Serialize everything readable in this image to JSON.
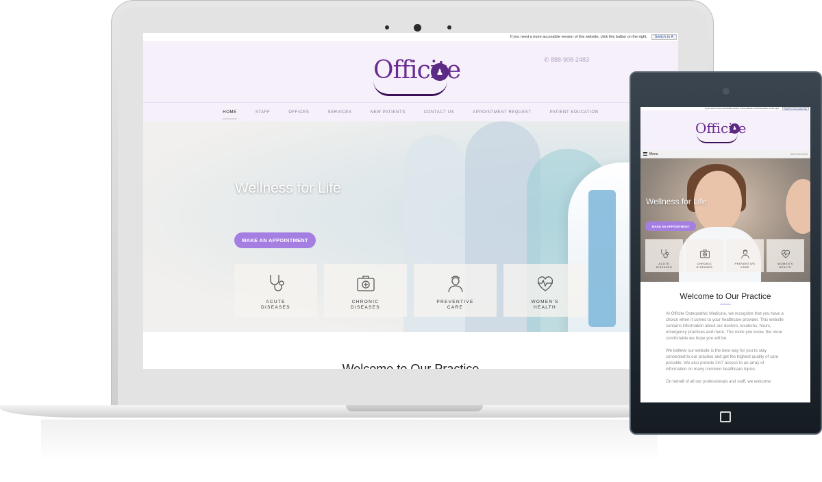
{
  "desktop": {
    "accessibility_notice": "If you need a more accessible version of this website, click this button on the right.",
    "accessibility_button": "Switch to A",
    "logo_text": "Officite",
    "phone": "888-908-2483",
    "nav": [
      "HOME",
      "STAFF",
      "OFFICES",
      "SERVICES",
      "NEW PATIENTS",
      "CONTACT US",
      "APPOINTMENT REQUEST",
      "PATIENT EDUCATION"
    ],
    "hero_title": "Wellness for Life",
    "cta_label": "MAKE AN APPOINTMENT",
    "cards": [
      {
        "line1": "ACUTE",
        "line2": "DISEASES",
        "icon": "stethoscope-icon"
      },
      {
        "line1": "CHRONIC",
        "line2": "DISEASES",
        "icon": "medical-kit-icon"
      },
      {
        "line1": "PREVENTIVE",
        "line2": "CARE",
        "icon": "nurse-icon"
      },
      {
        "line1": "WOMEN'S",
        "line2": "HEALTH",
        "icon": "heart-pulse-icon"
      }
    ],
    "welcome_title": "Welcome to Our Practice"
  },
  "tablet": {
    "accessibility_notice": "If you need a more accessible version of this website, click this button on the right.",
    "accessibility_button": "Switch to Accessible Site",
    "logo_text": "Officite",
    "menu_label": "Menu",
    "phone": "888-908-2483",
    "hero_title": "Wellness for Life",
    "cta_label": "MAKE AN APPOINTMENT",
    "cards": [
      {
        "line1": "ACUTE",
        "line2": "DISEASES"
      },
      {
        "line1": "CHRONIC",
        "line2": "DISEASES"
      },
      {
        "line1": "PREVENTIVE",
        "line2": "CARE"
      },
      {
        "line1": "WOMEN'S",
        "line2": "HEALTH"
      }
    ],
    "welcome_title": "Welcome to Our Practice",
    "paragraphs": [
      "At Officite Osteopathic Medicine, we recognize that you have a choice when it comes to your healthcare provider. This website contains information about our doctors, locations, hours, emergency practices and more. The more you know, the more comfortable we hope you will be.",
      "We believe our website is the best way for you to stay connected to our practice and get the highest quality of care possible. We also provide 24/7 access to an array of information on many common healthcare topics.",
      "On behalf of all our professionals and staff, we welcome"
    ]
  },
  "colors": {
    "brand_purple": "#6a2c91",
    "accent_lavender": "#a57ee2",
    "header_bg": "#f6f0fb"
  }
}
